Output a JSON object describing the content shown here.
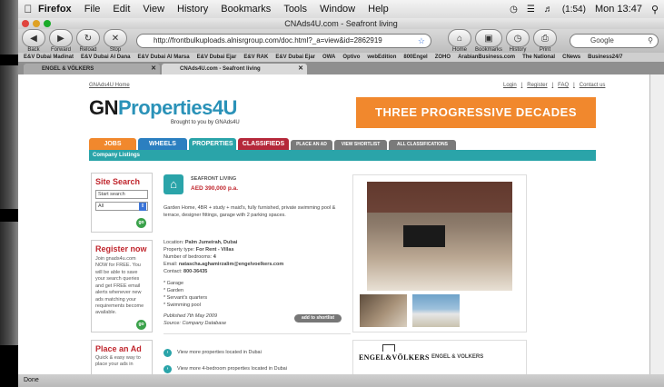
{
  "menubar": {
    "apple": "",
    "items": [
      "Firefox",
      "File",
      "Edit",
      "View",
      "History",
      "Bookmarks",
      "Tools",
      "Window",
      "Help"
    ],
    "battery": "(1:54)",
    "clock": "Mon 13:47"
  },
  "window": {
    "title": "CNAds4U.com - Seafront living"
  },
  "toolbar": {
    "back": "Back",
    "forward": "Forward",
    "reload": "Reload",
    "stop": "Stop",
    "url": "http://frontbulkuploads.alnisrgroup.com/doc.html?_a=view&id=2862919",
    "home": "Home",
    "bookmarks": "Bookmarks",
    "history": "History",
    "print": "Print",
    "search_placeholder": "Google"
  },
  "bookmarks": [
    "E&V Dubai Madinat",
    "E&V Dubai Al Dana",
    "E&V Dubai Al Marsa",
    "E&V Dubai Ejar",
    "E&V RAK",
    "E&V Dubai Ejar",
    "OWA",
    "Optivo",
    "webEdition",
    "800Engel",
    "ZOHO",
    "ArabianBusiness.com",
    "The National",
    "CNews",
    "Business24/7"
  ],
  "tabs": [
    {
      "label": "ENGEL & VÖLKERS",
      "active": false
    },
    {
      "label": "CNAds4U.com - Seafront living",
      "active": true
    }
  ],
  "page": {
    "home_link": "GNAds4U Home",
    "top_links": [
      "Login",
      "Register",
      "FAQ",
      "Contact us"
    ],
    "logo_gn": "GN",
    "logo_prop": "Properties4U",
    "logo_sub": "Brought to you by GNAds4U",
    "banner": "THREE PROGRESSIVE DECADES",
    "nav": [
      {
        "label": "JOBS",
        "color": "#f1882d"
      },
      {
        "label": "WHEELS",
        "color": "#2b7fc0"
      },
      {
        "label": "PROPERTIES",
        "color": "#2aa4a9"
      },
      {
        "label": "CLASSIFIEDS",
        "color": "#b5283a"
      }
    ],
    "subnav": [
      "PLACE AN AD",
      "VIEW SHORTLIST",
      "ALL CLASSIFICATIONS"
    ],
    "company_listings": "Company Listings",
    "site_search": {
      "title": "Site Search",
      "placeholder": "Start search",
      "select": "All",
      "go": "go"
    },
    "register": {
      "title": "Register now",
      "text": "Join gnads4u.com NOW for FREE. You will be able to save your search queries and get FREE email alerts whenever new ads matching your requirements become available.",
      "go": "go"
    },
    "place_ad": {
      "title": "Place an Ad",
      "text": "Quick & easy way to place your ads in"
    },
    "listing": {
      "title": "SEAFRONT LIVING",
      "price": "AED 390,000 p.a.",
      "description": "Garden Home, 4BR + study + maid's, fully furnished, private swimming pool & terrace, designer fittings, garage with 2 parking spaces.",
      "location_label": "Location:",
      "location": "Palm Jumeirah, Dubai",
      "type_label": "Property type:",
      "type": "For Rent - Villas",
      "bedrooms_label": "Number of bedrooms:",
      "bedrooms": "4",
      "email_label": "Email:",
      "email": "natascha.aghamirzalim@engelvoelkers.com",
      "contact_label": "Contact:",
      "contact": "800-36435",
      "features": [
        "* Garage",
        "* Garden",
        "* Servant's quarters",
        "* Swimming pool"
      ],
      "published": "Published 7th May 2009",
      "source": "Source: Company Database",
      "shortlist": "add to shortlist",
      "more1": "View more properties located in Dubai",
      "more2": "View more 4-bedroom properties located in Dubai"
    },
    "agent": {
      "logo": "ENGEL&VÖLKERS",
      "name": "ENGEL & VOLKERS"
    }
  },
  "status": "Done"
}
